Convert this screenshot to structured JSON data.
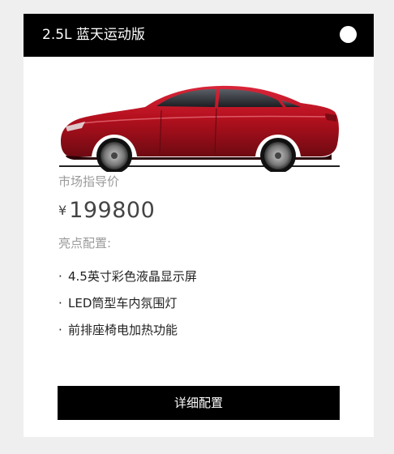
{
  "card": {
    "title": "2.5L 蓝天运动版",
    "price_label": "市场指导价",
    "price_currency": "¥",
    "price_value": "199800",
    "features_label": "亮点配置:",
    "features": [
      {
        "bullet": "·",
        "text": "4.5英寸彩色液晶显示屏"
      },
      {
        "bullet": "·",
        "text": "LED筒型车内氛围灯"
      },
      {
        "bullet": "·",
        "text": "前排座椅电加热功能"
      }
    ],
    "detail_button_label": "详细配置"
  },
  "colors": {
    "header_bg": "#000000",
    "card_bg": "#ffffff",
    "page_bg": "#efefef",
    "car_body": "#b5101e",
    "button_bg": "#000000"
  },
  "icons": {
    "toggle": "white-dot-toggle",
    "car": "red-sedan-image"
  }
}
